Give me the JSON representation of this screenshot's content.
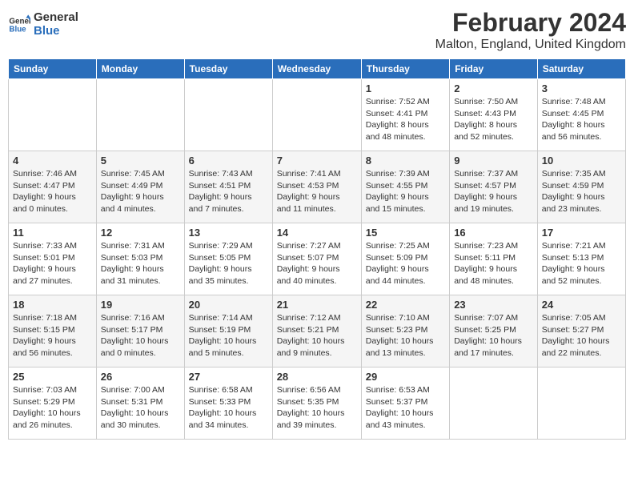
{
  "logo": {
    "line1": "General",
    "line2": "Blue"
  },
  "title": "February 2024",
  "subtitle": "Malton, England, United Kingdom",
  "weekdays": [
    "Sunday",
    "Monday",
    "Tuesday",
    "Wednesday",
    "Thursday",
    "Friday",
    "Saturday"
  ],
  "weeks": [
    [
      {
        "day": "",
        "info": ""
      },
      {
        "day": "",
        "info": ""
      },
      {
        "day": "",
        "info": ""
      },
      {
        "day": "",
        "info": ""
      },
      {
        "day": "1",
        "info": "Sunrise: 7:52 AM\nSunset: 4:41 PM\nDaylight: 8 hours\nand 48 minutes."
      },
      {
        "day": "2",
        "info": "Sunrise: 7:50 AM\nSunset: 4:43 PM\nDaylight: 8 hours\nand 52 minutes."
      },
      {
        "day": "3",
        "info": "Sunrise: 7:48 AM\nSunset: 4:45 PM\nDaylight: 8 hours\nand 56 minutes."
      }
    ],
    [
      {
        "day": "4",
        "info": "Sunrise: 7:46 AM\nSunset: 4:47 PM\nDaylight: 9 hours\nand 0 minutes."
      },
      {
        "day": "5",
        "info": "Sunrise: 7:45 AM\nSunset: 4:49 PM\nDaylight: 9 hours\nand 4 minutes."
      },
      {
        "day": "6",
        "info": "Sunrise: 7:43 AM\nSunset: 4:51 PM\nDaylight: 9 hours\nand 7 minutes."
      },
      {
        "day": "7",
        "info": "Sunrise: 7:41 AM\nSunset: 4:53 PM\nDaylight: 9 hours\nand 11 minutes."
      },
      {
        "day": "8",
        "info": "Sunrise: 7:39 AM\nSunset: 4:55 PM\nDaylight: 9 hours\nand 15 minutes."
      },
      {
        "day": "9",
        "info": "Sunrise: 7:37 AM\nSunset: 4:57 PM\nDaylight: 9 hours\nand 19 minutes."
      },
      {
        "day": "10",
        "info": "Sunrise: 7:35 AM\nSunset: 4:59 PM\nDaylight: 9 hours\nand 23 minutes."
      }
    ],
    [
      {
        "day": "11",
        "info": "Sunrise: 7:33 AM\nSunset: 5:01 PM\nDaylight: 9 hours\nand 27 minutes."
      },
      {
        "day": "12",
        "info": "Sunrise: 7:31 AM\nSunset: 5:03 PM\nDaylight: 9 hours\nand 31 minutes."
      },
      {
        "day": "13",
        "info": "Sunrise: 7:29 AM\nSunset: 5:05 PM\nDaylight: 9 hours\nand 35 minutes."
      },
      {
        "day": "14",
        "info": "Sunrise: 7:27 AM\nSunset: 5:07 PM\nDaylight: 9 hours\nand 40 minutes."
      },
      {
        "day": "15",
        "info": "Sunrise: 7:25 AM\nSunset: 5:09 PM\nDaylight: 9 hours\nand 44 minutes."
      },
      {
        "day": "16",
        "info": "Sunrise: 7:23 AM\nSunset: 5:11 PM\nDaylight: 9 hours\nand 48 minutes."
      },
      {
        "day": "17",
        "info": "Sunrise: 7:21 AM\nSunset: 5:13 PM\nDaylight: 9 hours\nand 52 minutes."
      }
    ],
    [
      {
        "day": "18",
        "info": "Sunrise: 7:18 AM\nSunset: 5:15 PM\nDaylight: 9 hours\nand 56 minutes."
      },
      {
        "day": "19",
        "info": "Sunrise: 7:16 AM\nSunset: 5:17 PM\nDaylight: 10 hours\nand 0 minutes."
      },
      {
        "day": "20",
        "info": "Sunrise: 7:14 AM\nSunset: 5:19 PM\nDaylight: 10 hours\nand 5 minutes."
      },
      {
        "day": "21",
        "info": "Sunrise: 7:12 AM\nSunset: 5:21 PM\nDaylight: 10 hours\nand 9 minutes."
      },
      {
        "day": "22",
        "info": "Sunrise: 7:10 AM\nSunset: 5:23 PM\nDaylight: 10 hours\nand 13 minutes."
      },
      {
        "day": "23",
        "info": "Sunrise: 7:07 AM\nSunset: 5:25 PM\nDaylight: 10 hours\nand 17 minutes."
      },
      {
        "day": "24",
        "info": "Sunrise: 7:05 AM\nSunset: 5:27 PM\nDaylight: 10 hours\nand 22 minutes."
      }
    ],
    [
      {
        "day": "25",
        "info": "Sunrise: 7:03 AM\nSunset: 5:29 PM\nDaylight: 10 hours\nand 26 minutes."
      },
      {
        "day": "26",
        "info": "Sunrise: 7:00 AM\nSunset: 5:31 PM\nDaylight: 10 hours\nand 30 minutes."
      },
      {
        "day": "27",
        "info": "Sunrise: 6:58 AM\nSunset: 5:33 PM\nDaylight: 10 hours\nand 34 minutes."
      },
      {
        "day": "28",
        "info": "Sunrise: 6:56 AM\nSunset: 5:35 PM\nDaylight: 10 hours\nand 39 minutes."
      },
      {
        "day": "29",
        "info": "Sunrise: 6:53 AM\nSunset: 5:37 PM\nDaylight: 10 hours\nand 43 minutes."
      },
      {
        "day": "",
        "info": ""
      },
      {
        "day": "",
        "info": ""
      }
    ]
  ]
}
